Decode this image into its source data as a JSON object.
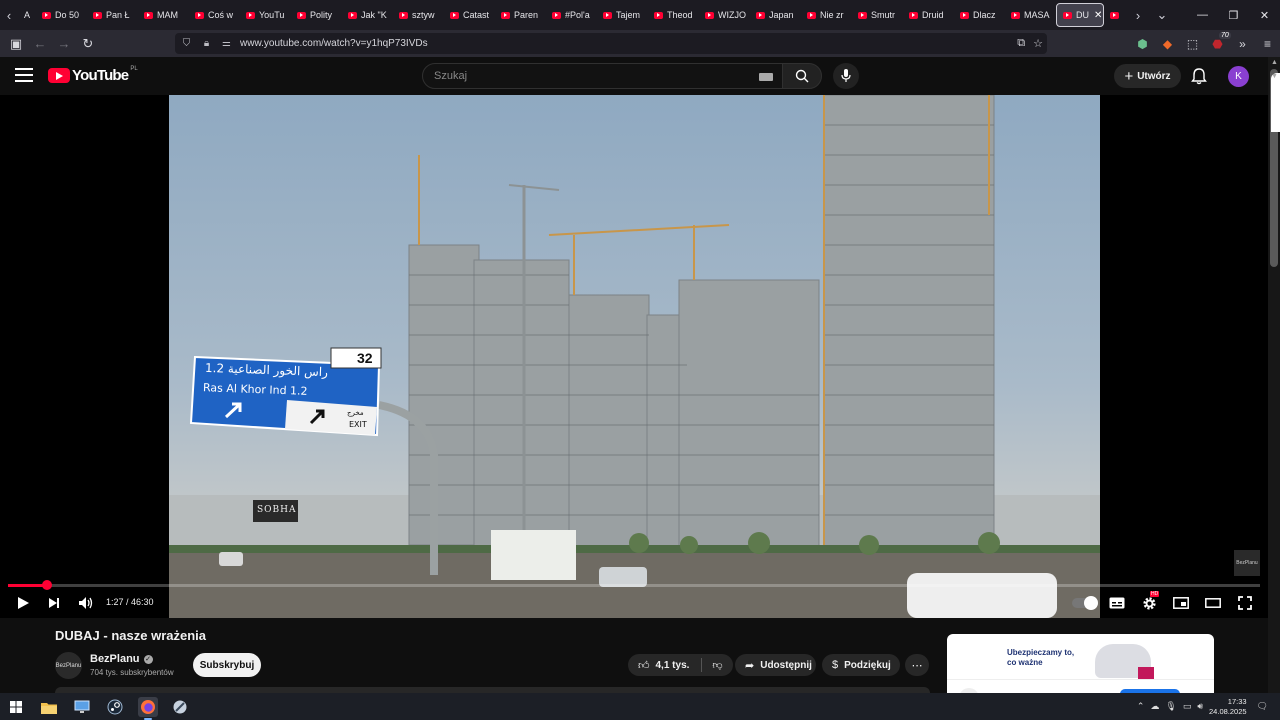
{
  "browser": {
    "tabs": [
      {
        "label": "Do 50"
      },
      {
        "label": "Pan Ł"
      },
      {
        "label": "MAM"
      },
      {
        "label": "Coś w"
      },
      {
        "label": "YouTu"
      },
      {
        "label": "Polity"
      },
      {
        "label": "Jak \"K"
      },
      {
        "label": "sztyw"
      },
      {
        "label": "Catast"
      },
      {
        "label": "Paren"
      },
      {
        "label": "#Pol'a"
      },
      {
        "label": "Tajem"
      },
      {
        "label": "Theod"
      },
      {
        "label": "WIZJO"
      },
      {
        "label": "Japan"
      },
      {
        "label": "Nie zr"
      },
      {
        "label": "Smutr"
      },
      {
        "label": "Druid"
      },
      {
        "label": "Dlacz"
      },
      {
        "label": "MASA"
      }
    ],
    "active_tab": {
      "label": "DU"
    },
    "first_partial_tab": "A",
    "url": "www.youtube.com/watch?v=y1hqP73IVDs",
    "url_domain": "youtube.com",
    "extension_badge": "70"
  },
  "youtube": {
    "logo_text": "YouTube",
    "region": "PL",
    "search_placeholder": "Szukaj",
    "create_label": "Utwórz",
    "avatar_letter": "K"
  },
  "player": {
    "time": "1:27 / 46:30",
    "progress_fraction": 0.0312,
    "watermark": "BezPlanu",
    "hd_badge": "HD"
  },
  "video_scene": {
    "sign_arabic": "راس الخور الصناعية 1.2",
    "sign_english": "Ras Al Khor Ind 1.2",
    "sign_exit": "EXIT",
    "sign_exit_arabic": "مخرج",
    "exit_number": "32",
    "building_sign": "SOBHA"
  },
  "video": {
    "title": "DUBAJ - nasze wrażenia",
    "channel": "BezPlanu",
    "channel_avatar_text": "BezPlanu",
    "subscribers": "704 tys. subskrybentów",
    "subscribe_label": "Subskrybuj",
    "likes": "4,1 tys.",
    "share_label": "Udostępnij",
    "thanks_label": "Podziękuj"
  },
  "ad": {
    "text_line1": "Ubezpieczamy to,",
    "text_line2": "co ważne"
  },
  "taskbar": {
    "time": "17:33",
    "date": "24.08.2025"
  }
}
